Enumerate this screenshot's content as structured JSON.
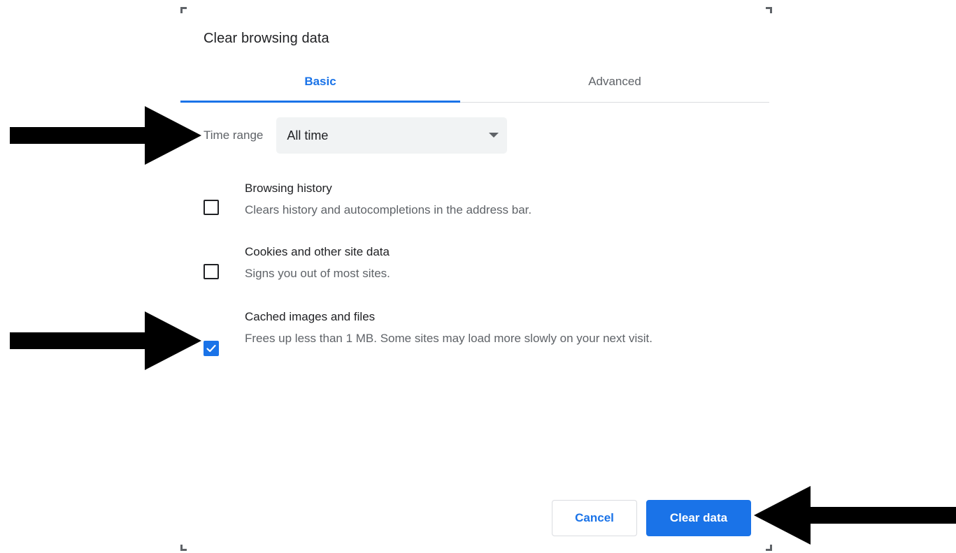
{
  "dialog": {
    "title": "Clear browsing data",
    "tabs": [
      {
        "label": "Basic",
        "selected": true
      },
      {
        "label": "Advanced",
        "selected": false
      }
    ],
    "time_range": {
      "label": "Time range",
      "selected_value": "All time"
    },
    "options": [
      {
        "label": "Browsing history",
        "description": "Clears history and autocompletions in the address bar.",
        "checked": false
      },
      {
        "label": "Cookies and other site data",
        "description": "Signs you out of most sites.",
        "checked": false
      },
      {
        "label": "Cached images and files",
        "description": "Frees up less than 1 MB. Some sites may load more slowly on your next visit.",
        "checked": true
      }
    ],
    "buttons": {
      "cancel": "Cancel",
      "clear": "Clear data"
    }
  },
  "colors": {
    "accent": "#1a73e8",
    "annotation_arrow": "#000000"
  },
  "icons": [
    "dropdown-caret-icon",
    "checkmark-icon",
    "annotation-arrow"
  ]
}
